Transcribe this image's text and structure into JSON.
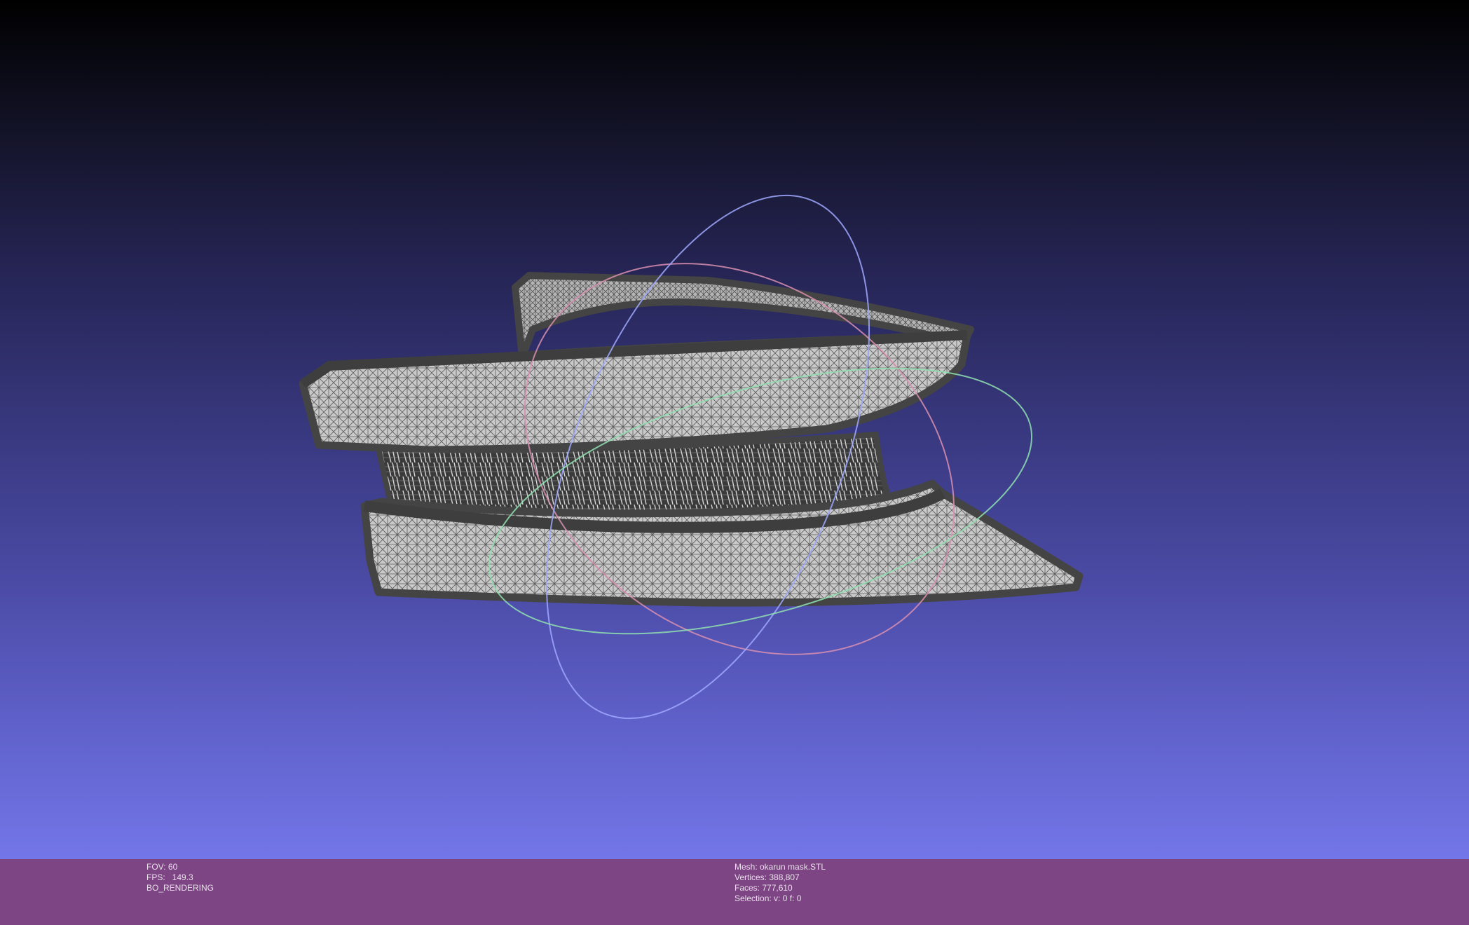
{
  "viewer": {
    "background_top": "#000000",
    "background_bottom": "#7376e8",
    "mesh_fill": "#c9c9c9",
    "mesh_edge": "#4a4a4a",
    "trackball": {
      "ring_x_color": "#d98fb0",
      "ring_y_color": "#9fa8ff",
      "ring_z_color": "#8fe0b0"
    }
  },
  "status": {
    "left": {
      "fov": "FOV: 60",
      "fps": "FPS:   149.3",
      "mode": "BO_RENDERING"
    },
    "right": {
      "mesh": "Mesh: okarun mask.STL",
      "vertices": "Vertices: 388,807",
      "faces": "Faces: 777,610",
      "selection": "Selection: v: 0 f: 0"
    }
  }
}
